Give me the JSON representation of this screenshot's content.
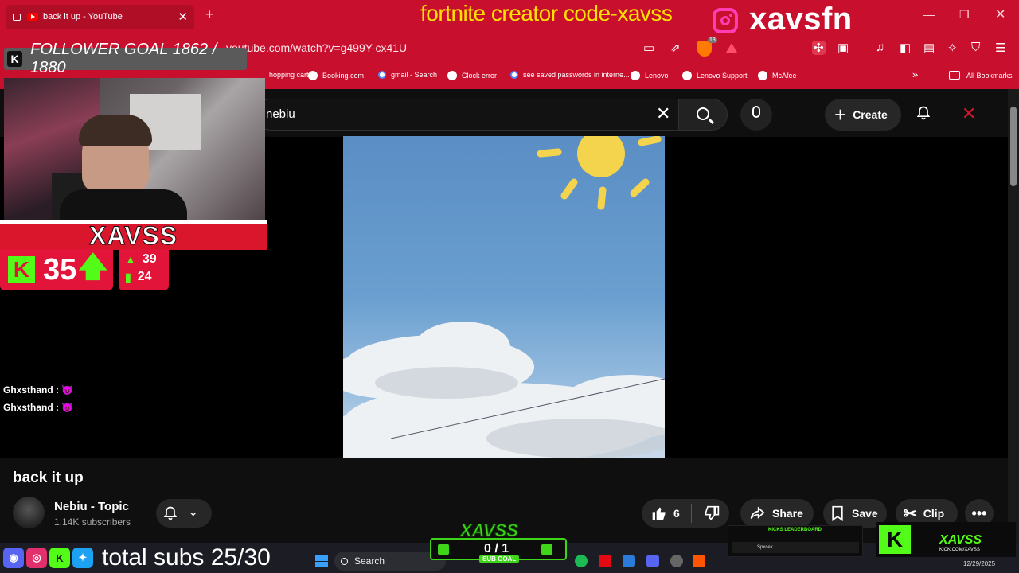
{
  "browser": {
    "tab_title": "back it up - YouTube",
    "new_tab": "+",
    "url": "youtube.com/watch?v=g499Y-cx41U",
    "brave_count": "13",
    "bookmarks": [
      {
        "label": "hopping cart"
      },
      {
        "label": "Booking.com"
      },
      {
        "label": "gmail - Search"
      },
      {
        "label": "Clock error"
      },
      {
        "label": "see saved passwords in interne..."
      },
      {
        "label": "Lenovo"
      },
      {
        "label": "Lenovo Support"
      },
      {
        "label": "McAfee"
      }
    ],
    "all_bookmarks": "All Bookmarks",
    "more_bookmarks": "»"
  },
  "overlay": {
    "creator_code": "fortnite creator code-xavss",
    "instagram_handle": "xavsfn",
    "follower_goal": "FOLLOWER GOAL 1862 / 1880",
    "follower_icon": "K",
    "streamer_name": "XAVSS",
    "kick_letter": "K",
    "viewer_count": "35",
    "stat_top": "39",
    "stat_bottom": "24",
    "chat": [
      {
        "user": "Ghxsthand :",
        "emote": "😈"
      },
      {
        "user": "Ghxsthand :",
        "emote": "😈"
      }
    ],
    "total_subs": "total subs 25/30",
    "sub_goal_brand": "XAVSS",
    "sub_goal_value": "0 / 1",
    "sub_goal_label": "SUB GOAL",
    "leaderboard_title": "KICKS LEADERBOARD",
    "leaderboard_user": "Spxcex",
    "kick_brand": "XAVSS",
    "kick_url": "KICK.COM/XAVSS"
  },
  "youtube": {
    "search_value": "nebiu",
    "create_label": "Create",
    "video_title": "back it up",
    "channel_name": "Nebiu - Topic",
    "channel_subs": "1.14K subscribers",
    "like_count": "6",
    "share_label": "Share",
    "save_label": "Save",
    "clip_label": "Clip",
    "more_label": "•••"
  },
  "taskbar": {
    "search_label": "Search",
    "date": "12/29/2025"
  },
  "colors": {
    "browser_red": "#c8102e",
    "kick_green": "#53fc18",
    "youtube_bg": "#0f0f0f",
    "overlay_yellow": "#ffe100",
    "instagram_pink": "#ff3db4"
  }
}
